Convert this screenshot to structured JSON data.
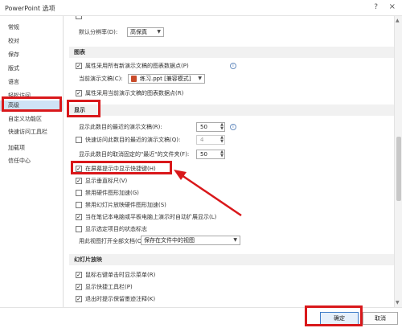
{
  "window": {
    "title": "PowerPoint 选项",
    "help_icon": "?",
    "close_icon": "×"
  },
  "sidebar": {
    "items": [
      {
        "label": "常规"
      },
      {
        "label": "校对"
      },
      {
        "label": "保存"
      },
      {
        "label": "版式"
      },
      {
        "label": "语言"
      },
      {
        "label": "轻松访问"
      },
      {
        "label": "高级"
      },
      {
        "label": "自定义功能区"
      },
      {
        "label": "快速访问工具栏"
      },
      {
        "label": "加载项"
      },
      {
        "label": "信任中心"
      }
    ],
    "selected": "高级"
  },
  "top": {
    "resolution_label": "默认分辨率(D):",
    "resolution_value": "高保真"
  },
  "chart": {
    "header": "图表",
    "properties_all": "属性采用所有新演示文稿的图表数据点(P)",
    "current_doc_label": "当前演示文稿(C):",
    "current_doc_value": "练习.ppt [兼容模式]",
    "properties_current": "属性采用当前演示文稿的图表数据点(R)"
  },
  "display": {
    "header": "显示",
    "recent_docs_label": "显示此数目的最近的演示文稿(R):",
    "recent_docs_value": "50",
    "quick_access_label": "快速访问此数目的最近的演示文稿(Q):",
    "quick_access_value": "4",
    "unpinned_folders_label": "显示此数目的取消固定的\"最近\"的文件夹(F):",
    "unpinned_folders_value": "50",
    "show_shortcut_keys": "在屏幕提示中显示快捷键(H)",
    "show_vertical_ruler": "显示垂直标尺(V)",
    "disable_hw_accel": "禁用硬件图形加速(G)",
    "disable_slideshow_hw_accel": "禁用幻灯片放映硬件图形加速(S)",
    "auto_extend": "当在笔记本电脑或平板电脑上演示时自动扩展显示(L)",
    "show_popup_indicator": "显示选定项目的状态标志",
    "open_view_label": "用此视图打开全部文档(O)",
    "open_view_value": "保存在文件中的视图"
  },
  "slideshow": {
    "header": "幻灯片放映",
    "right_click_menu": "鼠标右键单击时显示菜单(R)",
    "popup_toolbar": "显示快捷工具栏(P)",
    "keep_ink": "退出时提示保留墨迹注释(K)"
  },
  "footer": {
    "ok": "确定",
    "cancel": "取消"
  },
  "colors": {
    "highlight_red": "#d9181b",
    "selected_bg": "#cfe3f5"
  }
}
